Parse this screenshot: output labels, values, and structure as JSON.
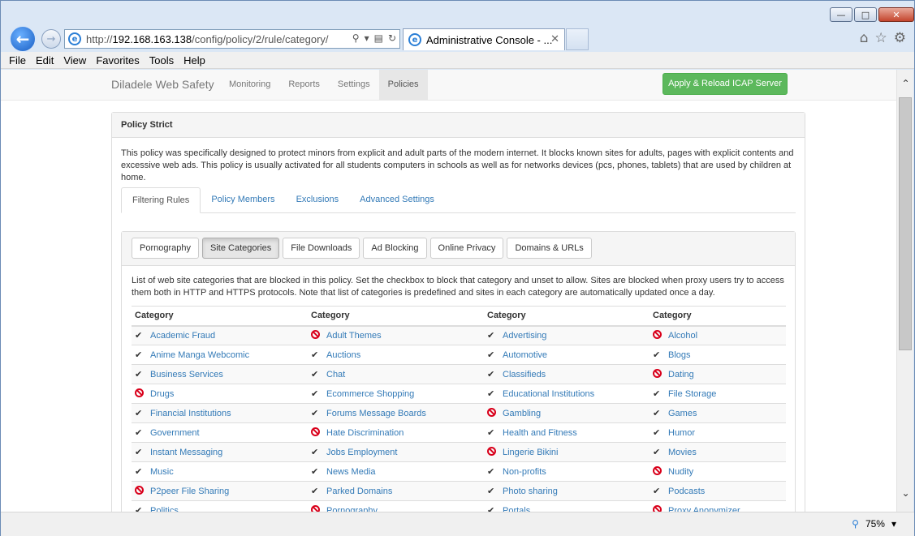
{
  "browser": {
    "address_prefix": "http://",
    "address_host": "192.168.163.138",
    "address_path": "/config/policy/2/rule/category/",
    "tab_title": "Administrative Console - ...",
    "menu": [
      "File",
      "Edit",
      "View",
      "Favorites",
      "Tools",
      "Help"
    ],
    "zoom": "75%"
  },
  "navbar": {
    "brand": "Diladele Web Safety",
    "items": [
      "Monitoring",
      "Reports",
      "Settings",
      "Policies"
    ],
    "active": "Policies",
    "apply_button": "Apply & Reload ICAP Server"
  },
  "policy": {
    "title": "Policy Strict",
    "description": "This policy was specifically designed to protect minors from explicit and adult parts of the modern internet. It blocks known sites for adults, pages with explicit contents and excessive web ads. This policy is usually activated for all students computers in schools as well as for networks devices (pcs, phones, tablets) that are used by children at home.",
    "tabs": [
      "Filtering Rules",
      "Policy Members",
      "Exclusions",
      "Advanced Settings"
    ],
    "active_tab": "Filtering Rules",
    "rule_buttons": [
      "Pornography",
      "Site Categories",
      "File Downloads",
      "Ad Blocking",
      "Online Privacy",
      "Domains & URLs"
    ],
    "active_rule": "Site Categories",
    "categories_description": "List of web site categories that are blocked in this policy. Set the checkbox to block that category and unset to allow. Sites are blocked when proxy users try to access them both in HTTP and HTTPS protocols. Note that list of categories is predefined and sites in each category are automatically updated once a day."
  },
  "table": {
    "headers": [
      "Category",
      "Category",
      "Category",
      "Category"
    ],
    "rows": [
      [
        {
          "name": "Academic Fraud",
          "status": "allowed"
        },
        {
          "name": "Adult Themes",
          "status": "blocked"
        },
        {
          "name": "Advertising",
          "status": "allowed"
        },
        {
          "name": "Alcohol",
          "status": "blocked"
        }
      ],
      [
        {
          "name": "Anime Manga Webcomic",
          "status": "allowed"
        },
        {
          "name": "Auctions",
          "status": "allowed"
        },
        {
          "name": "Automotive",
          "status": "allowed"
        },
        {
          "name": "Blogs",
          "status": "allowed"
        }
      ],
      [
        {
          "name": "Business Services",
          "status": "allowed"
        },
        {
          "name": "Chat",
          "status": "allowed"
        },
        {
          "name": "Classifieds",
          "status": "allowed"
        },
        {
          "name": "Dating",
          "status": "blocked"
        }
      ],
      [
        {
          "name": "Drugs",
          "status": "blocked"
        },
        {
          "name": "Ecommerce Shopping",
          "status": "allowed"
        },
        {
          "name": "Educational Institutions",
          "status": "allowed"
        },
        {
          "name": "File Storage",
          "status": "allowed"
        }
      ],
      [
        {
          "name": "Financial Institutions",
          "status": "allowed"
        },
        {
          "name": "Forums Message Boards",
          "status": "allowed"
        },
        {
          "name": "Gambling",
          "status": "blocked"
        },
        {
          "name": "Games",
          "status": "allowed"
        }
      ],
      [
        {
          "name": "Government",
          "status": "allowed"
        },
        {
          "name": "Hate Discrimination",
          "status": "blocked"
        },
        {
          "name": "Health and Fitness",
          "status": "allowed"
        },
        {
          "name": "Humor",
          "status": "allowed"
        }
      ],
      [
        {
          "name": "Instant Messaging",
          "status": "allowed"
        },
        {
          "name": "Jobs Employment",
          "status": "allowed"
        },
        {
          "name": "Lingerie Bikini",
          "status": "blocked"
        },
        {
          "name": "Movies",
          "status": "allowed"
        }
      ],
      [
        {
          "name": "Music",
          "status": "allowed"
        },
        {
          "name": "News Media",
          "status": "allowed"
        },
        {
          "name": "Non-profits",
          "status": "allowed"
        },
        {
          "name": "Nudity",
          "status": "blocked"
        }
      ],
      [
        {
          "name": "P2peer File Sharing",
          "status": "blocked"
        },
        {
          "name": "Parked Domains",
          "status": "allowed"
        },
        {
          "name": "Photo sharing",
          "status": "allowed"
        },
        {
          "name": "Podcasts",
          "status": "allowed"
        }
      ],
      [
        {
          "name": "Politics",
          "status": "allowed"
        },
        {
          "name": "Pornography",
          "status": "blocked"
        },
        {
          "name": "Portals",
          "status": "allowed"
        },
        {
          "name": "Proxy Anonymizer",
          "status": "blocked"
        }
      ]
    ]
  }
}
